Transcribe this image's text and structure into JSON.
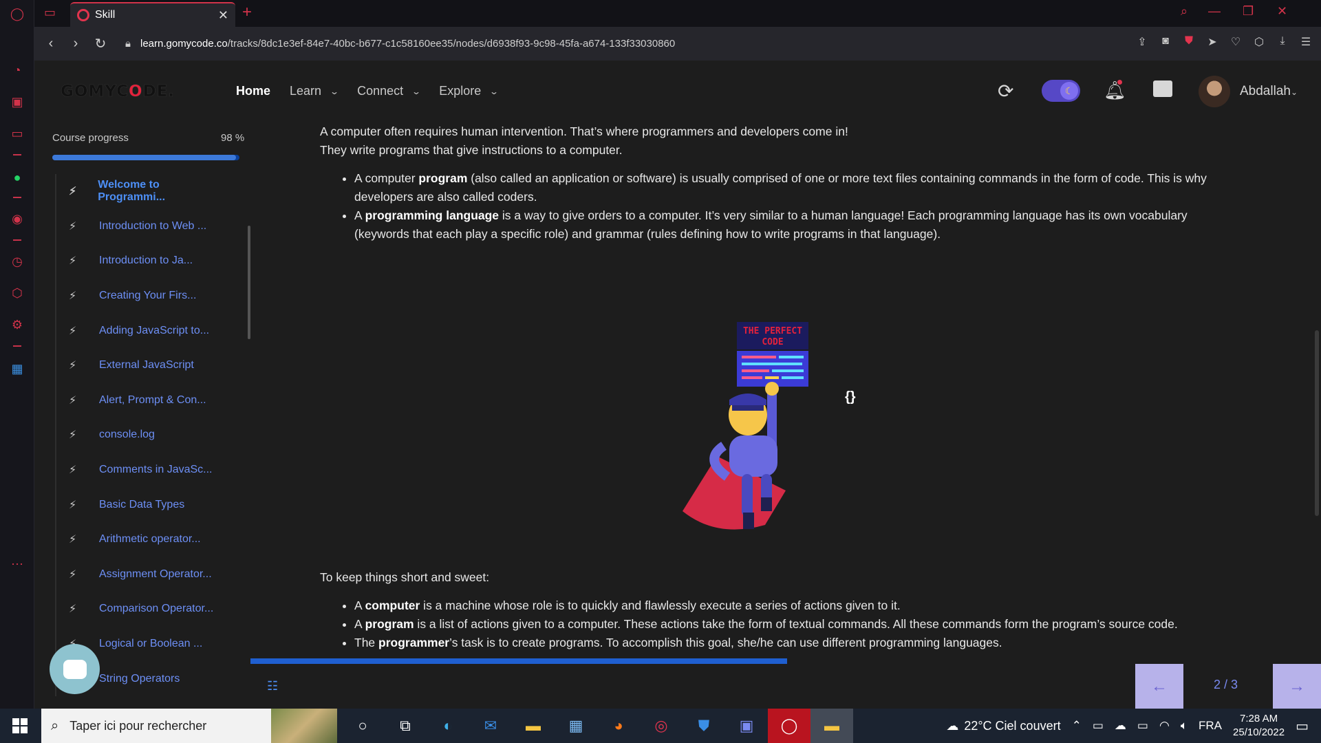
{
  "browser": {
    "tab_title": "Skill",
    "url_domain": "learn.gomycode.co",
    "url_path": "/tracks/8dc1e3ef-84e7-40bc-b677-c1c58160ee35/nodes/d6938f93-9c98-45fa-a674-133f33030860"
  },
  "header": {
    "logo_pre": "GOMYC",
    "logo_o": "O",
    "logo_post": "DE.",
    "nav": [
      {
        "label": "Home"
      },
      {
        "label": "Learn"
      },
      {
        "label": "Connect"
      },
      {
        "label": "Explore"
      }
    ],
    "username": "Abdallah"
  },
  "sidebar": {
    "progress_label": "Course progress",
    "progress_pct_text": "98 %",
    "progress_value": 0.98,
    "lessons": [
      {
        "label": "Welcome to Programmi..."
      },
      {
        "label": "Introduction to Web ..."
      },
      {
        "label": "Introduction to Ja..."
      },
      {
        "label": "Creating Your Firs..."
      },
      {
        "label": "Adding JavaScript to..."
      },
      {
        "label": "External JavaScript"
      },
      {
        "label": "Alert, Prompt & Con..."
      },
      {
        "label": "console.log"
      },
      {
        "label": "Comments in JavaSc..."
      },
      {
        "label": "Basic Data Types"
      },
      {
        "label": "Arithmetic operator..."
      },
      {
        "label": "Assignment Operator..."
      },
      {
        "label": "Comparison Operator..."
      },
      {
        "label": "Logical or Boolean ..."
      },
      {
        "label": "String Operators"
      }
    ]
  },
  "content": {
    "intro_line1": "A computer often requires human intervention. That’s where programmers and developers come in!",
    "intro_line2": "They write programs that give instructions to a computer.",
    "bullets1": [
      {
        "pre": "A computer ",
        "bold": "program",
        "post": " (also called an application or software) is usually comprised of one or more text files containing commands in the form of code. This is why developers are also called coders."
      },
      {
        "pre": "A ",
        "bold": "programming language",
        "post": " is a way to give orders to a computer. It’s very similar to a human language! Each programming language has its own vocabulary (keywords that each play a specific role) and grammar (rules defining how to write programs in that language)."
      }
    ],
    "illustration_title_1": "THE PERFECT",
    "illustration_title_2": "CODE",
    "braces": "{}",
    "summary_intro": "To keep things short and sweet:",
    "bullets2": [
      {
        "pre": "A ",
        "bold": "computer",
        "post": " is a machine whose role is to quickly and flawlessly execute a series of actions given to it."
      },
      {
        "pre": "A ",
        "bold": "program",
        "post": " is a list of actions given to a computer. These actions take the form of textual commands. All these commands form the program’s source code."
      },
      {
        "pre": "The ",
        "bold": "programmer",
        "post": "’s task is to create programs. To accomplish this goal, she/he can use different programming languages."
      }
    ]
  },
  "pager": {
    "page_text": "2 / 3",
    "prev_icon": "arrow-left-icon",
    "next_icon": "arrow-right-icon"
  },
  "taskbar": {
    "search_placeholder": "Taper ici pour rechercher",
    "weather": "22°C  Ciel couvert",
    "language": "FRA",
    "time": "7:28 AM",
    "date": "25/10/2022"
  },
  "colors": {
    "accent_blue": "#3c79d9",
    "link_blue": "#6d8ff5",
    "opera_red": "#d2334a",
    "pager_bg": "#b7b2ea"
  }
}
